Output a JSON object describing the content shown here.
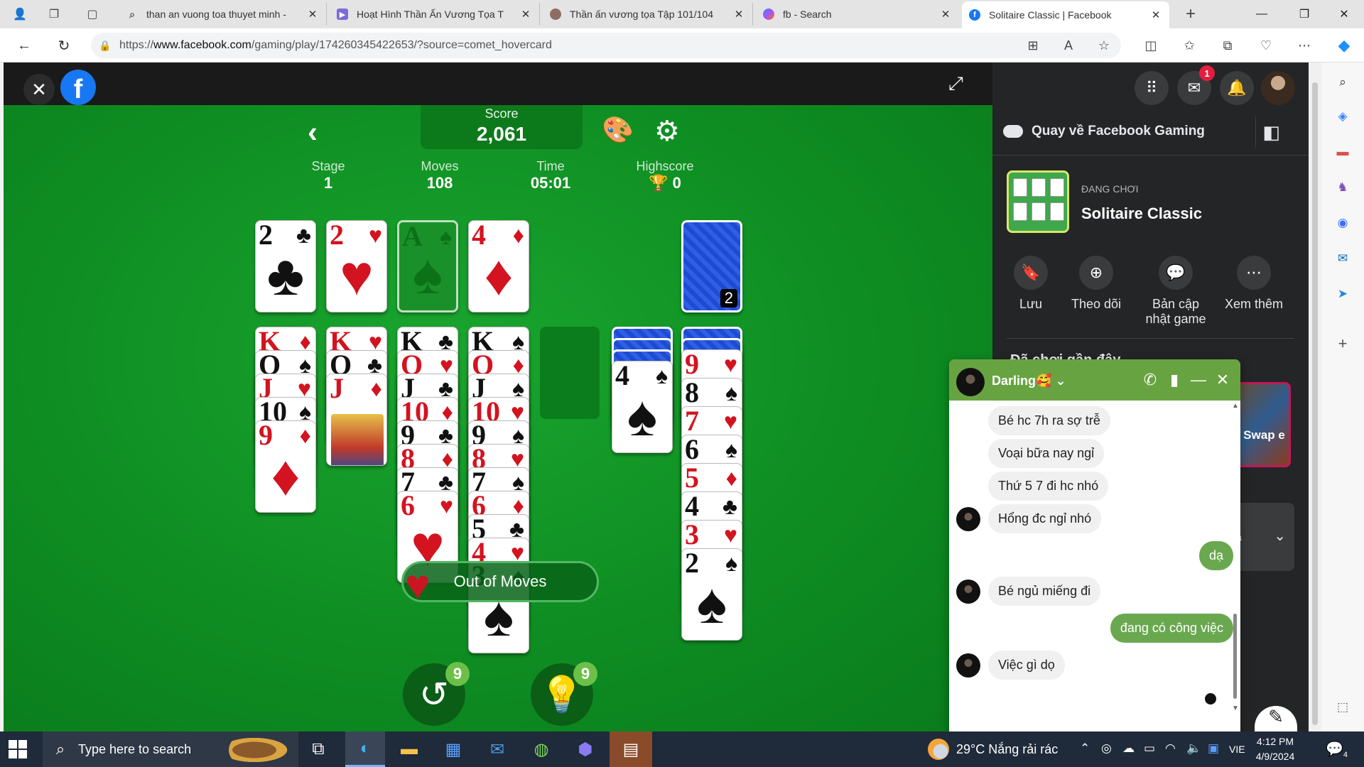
{
  "browser": {
    "tabs": [
      {
        "title": "than an vuong toa thuyet minh -",
        "icon": "search-icon"
      },
      {
        "title": "Hoạt Hình Thần Ấn Vương Tọa T",
        "icon": "video-icon"
      },
      {
        "title": "Thần ấn vương tọa Tập 101/104",
        "icon": "avatar-icon"
      },
      {
        "title": "fb - Search",
        "icon": "copilot-icon"
      },
      {
        "title": "Solitaire Classic | Facebook",
        "icon": "facebook-icon"
      }
    ],
    "url_prefix": "https://",
    "url_host": "www.facebook.com",
    "url_path": "/gaming/play/174260345422653/?source=comet_hovercard"
  },
  "game": {
    "score_label": "Score",
    "score_value": "2,061",
    "stats": [
      {
        "label": "Stage",
        "value": "1"
      },
      {
        "label": "Moves",
        "value": "108"
      },
      {
        "label": "Time",
        "value": "05:01"
      },
      {
        "label": "Highscore",
        "value": "🏆 0"
      }
    ],
    "foundations": [
      {
        "rank": "2",
        "suit": "♣",
        "color": "blk"
      },
      {
        "rank": "2",
        "suit": "♥",
        "color": "red"
      },
      {
        "rank": "A",
        "suit": "♠",
        "color": "ghost"
      },
      {
        "rank": "4",
        "suit": "♦",
        "color": "red"
      }
    ],
    "stock_count": "2",
    "out_of_moves": "Out of Moves",
    "undo_badge": "9",
    "hint_badge": "9"
  },
  "panel": {
    "messenger_badge": "1",
    "back_link": "Quay về Facebook Gaming",
    "playing_label": "ĐANG CHƠI",
    "game_name": "Solitaire Classic",
    "actions": [
      "Lưu",
      "Theo dõi",
      "Bản cập nhật game",
      "Xem thêm"
    ],
    "recent_title": "Đã chơi gần đây",
    "recent_game": "c Swap e",
    "box_text": "và"
  },
  "chat": {
    "name": "Darling🥰",
    "messages": [
      {
        "dir": "in",
        "text": "Bé hc 7h ra sợ trễ"
      },
      {
        "dir": "in",
        "text": "Voại bữa nay ngỉ"
      },
      {
        "dir": "in",
        "text": "Thứ 5 7 đi hc nhó"
      },
      {
        "dir": "in",
        "text": "Hổng đc ngỉ nhó"
      },
      {
        "dir": "out",
        "text": "dạ"
      },
      {
        "dir": "in",
        "text": "Bé ngủ miếng đi"
      },
      {
        "dir": "out",
        "text": "đang có công việc"
      },
      {
        "dir": "in",
        "text": "Việc gì dọ"
      }
    ]
  },
  "taskbar": {
    "search_placeholder": "Type here to search",
    "weather": "29°C  Nắng rải rác",
    "lang": "VIE",
    "time": "4:12 PM",
    "date": "4/9/2024",
    "notifications": "4"
  }
}
